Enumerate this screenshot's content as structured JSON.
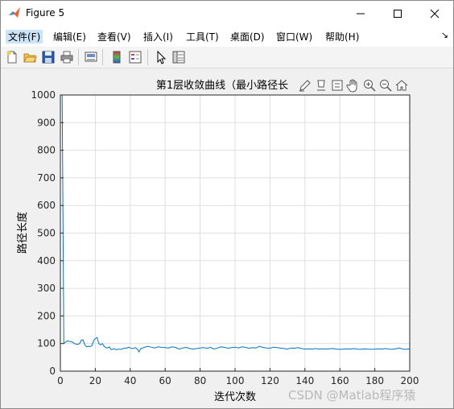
{
  "window": {
    "title": "Figure 5"
  },
  "menu": {
    "items": [
      "文件(F)",
      "编辑(E)",
      "查看(V)",
      "插入(I)",
      "工具(T)",
      "桌面(D)",
      "窗口(W)",
      "帮助(H)"
    ],
    "overflow_glyph": "↘"
  },
  "toolbar": {
    "buttons": [
      "new-figure-icon",
      "open-icon",
      "save-icon",
      "print-icon",
      "link-plot-icon",
      "colorbar-icon",
      "legend-icon",
      "pointer-icon",
      "property-editor-icon"
    ]
  },
  "axes_toolbar": {
    "buttons": [
      "brush-icon",
      "data-tips-icon",
      "insert-icon",
      "pan-icon",
      "zoom-in-icon",
      "zoom-out-icon",
      "home-icon"
    ]
  },
  "watermark": "CSDN @Matlab程序猿",
  "colors": {
    "line": "#0072bd",
    "grid": "#dfdfdf",
    "axes_bg": "#ffffff",
    "titlebar_active": "#cce4f7"
  },
  "chart_data": {
    "type": "line",
    "title": "第1层收敛曲线（最小路径长",
    "xlabel": "迭代次数",
    "ylabel": "路径长度",
    "xlim": [
      0,
      200
    ],
    "ylim": [
      0,
      1000
    ],
    "xticks": [
      "0",
      "20",
      "40",
      "60",
      "80",
      "100",
      "120",
      "140",
      "160",
      "180",
      "200"
    ],
    "yticks": [
      "0",
      "100",
      "200",
      "300",
      "400",
      "500",
      "600",
      "700",
      "800",
      "900",
      "1000"
    ],
    "grid": true,
    "series": [
      {
        "x": [
          1,
          2,
          3,
          4,
          5,
          6,
          7,
          8,
          9,
          10,
          11,
          12,
          13,
          14,
          15,
          16,
          17,
          18,
          19,
          20,
          21,
          22,
          23,
          24,
          25,
          26,
          27,
          28,
          29,
          30,
          31,
          32,
          33,
          34,
          35,
          36,
          37,
          38,
          39,
          40,
          41,
          42,
          43,
          44,
          45,
          46,
          47,
          48,
          49,
          50,
          52,
          54,
          56,
          58,
          60,
          62,
          64,
          66,
          68,
          70,
          72,
          74,
          76,
          78,
          80,
          82,
          84,
          86,
          88,
          90,
          92,
          94,
          96,
          98,
          100,
          102,
          104,
          106,
          108,
          110,
          112,
          114,
          116,
          118,
          120,
          122,
          124,
          126,
          128,
          130,
          132,
          134,
          136,
          138,
          140,
          142,
          144,
          146,
          148,
          150,
          152,
          154,
          156,
          158,
          160,
          162,
          164,
          166,
          168,
          170,
          172,
          174,
          176,
          178,
          180,
          182,
          184,
          186,
          188,
          190,
          192,
          194,
          196,
          198,
          200
        ],
        "y": [
          1000,
          100,
          105,
          110,
          108,
          107,
          105,
          100,
          98,
          97,
          100,
          112,
          113,
          95,
          88,
          90,
          89,
          92,
          110,
          118,
          122,
          100,
          95,
          100,
          90,
          85,
          84,
          88,
          78,
          80,
          82,
          77,
          80,
          79,
          79,
          82,
          84,
          83,
          87,
          84,
          82,
          83,
          85,
          80,
          70,
          82,
          84,
          86,
          88,
          90,
          87,
          84,
          88,
          86,
          85,
          84,
          88,
          86,
          80,
          84,
          86,
          82,
          80,
          82,
          84,
          85,
          83,
          86,
          80,
          84,
          88,
          86,
          83,
          85,
          87,
          84,
          88,
          86,
          83,
          85,
          84,
          90,
          86,
          84,
          83,
          87,
          85,
          84,
          82,
          80,
          84,
          83,
          85,
          82,
          80,
          81,
          80,
          82,
          80,
          81,
          80,
          81,
          82,
          80,
          79,
          80,
          81,
          80,
          82,
          80,
          79,
          81,
          80,
          79,
          80,
          81,
          80,
          82,
          80,
          79,
          81,
          84,
          80,
          79,
          81
        ]
      }
    ]
  }
}
